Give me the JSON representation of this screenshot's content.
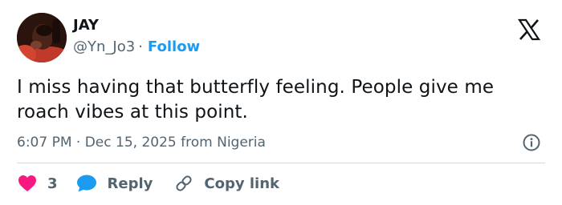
{
  "user": {
    "display_name": "JAY",
    "handle": "@Yn_Jo3",
    "separator": "·",
    "follow_label": "Follow"
  },
  "tweet": {
    "text": "I miss having that butterfly feeling. People give me roach vibes at this point.",
    "time": "6:07 PM",
    "meta_separator": "·",
    "date": "Dec 15, 2025",
    "location": "from Nigeria"
  },
  "actions": {
    "like_count": "3",
    "reply_label": "Reply",
    "copy_link_label": "Copy link"
  },
  "icons": {
    "platform_logo": "x-logo-icon",
    "info": "info-icon",
    "like": "heart-icon",
    "reply": "speech-bubble-icon",
    "copy": "link-icon"
  },
  "colors": {
    "text_primary": "#0f1419",
    "text_secondary": "#536471",
    "link_blue": "#1d9bf0",
    "like_red": "#f91880",
    "divider": "#cfd9de"
  }
}
